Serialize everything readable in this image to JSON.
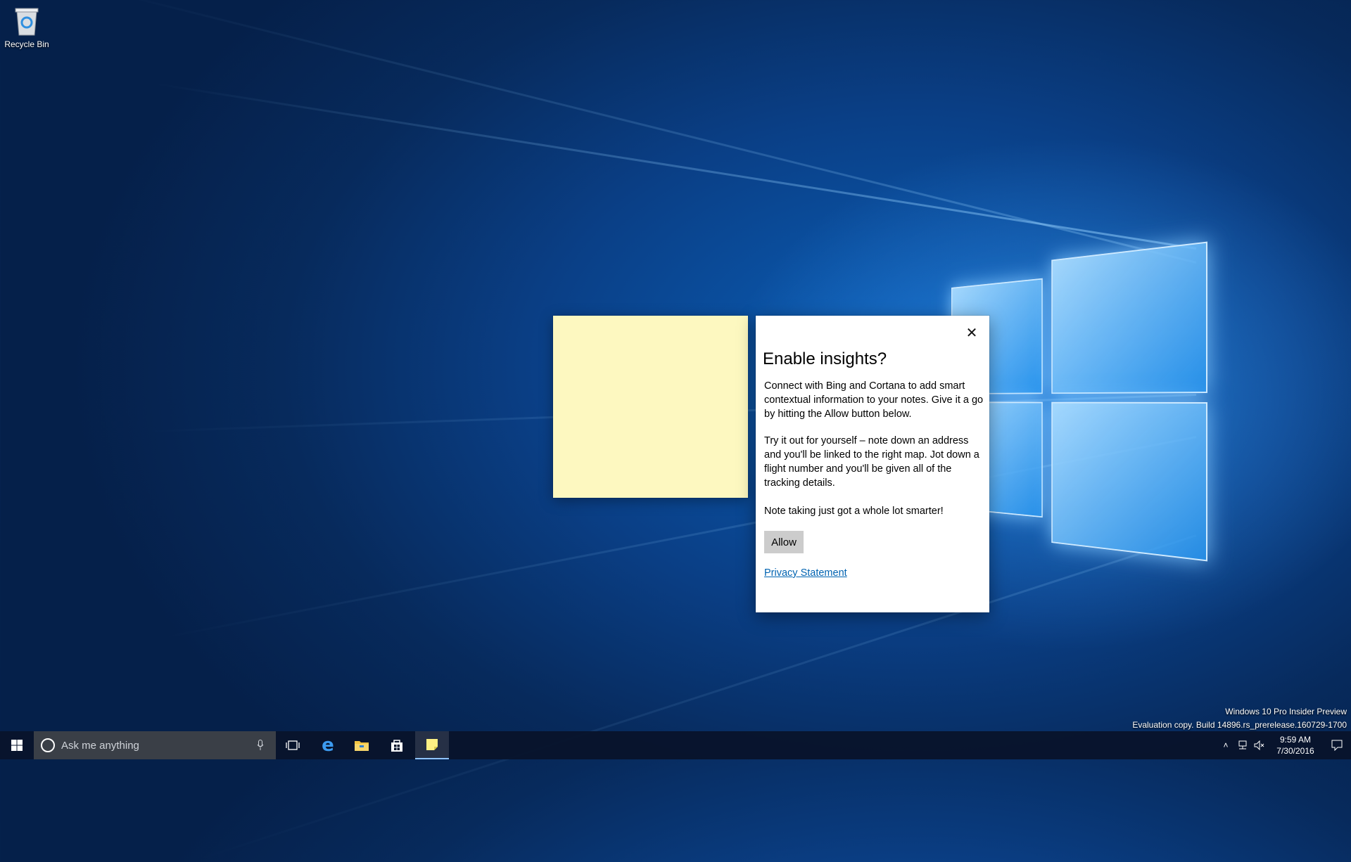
{
  "desktop": {
    "icons": [
      {
        "label": "Recycle Bin",
        "icon": "recycle-bin-icon"
      }
    ]
  },
  "dialog": {
    "title": "Enable insights?",
    "close_icon": "close-icon",
    "paragraph1": "Connect with Bing and Cortana to add smart contextual information to your notes. Give it a go by hitting the Allow button below.",
    "paragraph2": "Try it out for yourself – note down an address and you'll be linked to the right map. Jot down a flight number and you'll be given all of the tracking details.",
    "paragraph3": "Note taking just got a whole lot smarter!",
    "allow_label": "Allow",
    "privacy_link": "Privacy Statement"
  },
  "sticky_note": {
    "color": "#fdf8c0"
  },
  "watermark": {
    "line1": "Windows 10 Pro Insider Preview",
    "line2": "Evaluation copy. Build 14896.rs_prerelease.160729-1700"
  },
  "taskbar": {
    "search_placeholder": "Ask me anything",
    "apps": [
      "task-view-icon",
      "edge-icon",
      "file-explorer-icon",
      "store-icon",
      "sticky-notes-icon"
    ],
    "clock_time": "9:59 AM",
    "clock_date": "7/30/2016"
  },
  "colors": {
    "accent": "#0063b1",
    "taskbar": "#08142c"
  }
}
